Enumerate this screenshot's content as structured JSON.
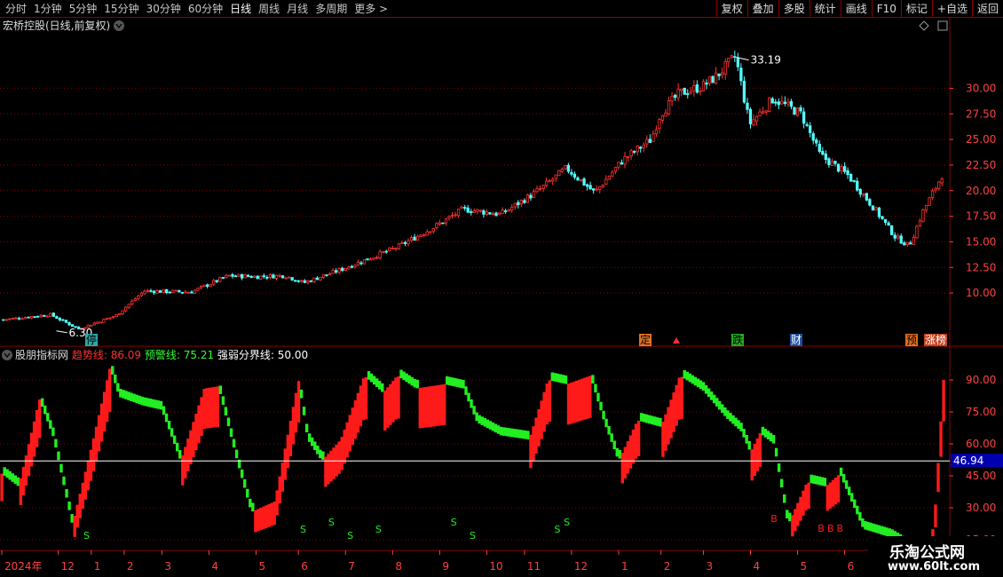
{
  "toolbar": {
    "periods": [
      "分时",
      "1分钟",
      "5分钟",
      "15分钟",
      "30分钟",
      "60分钟",
      "日线",
      "周线",
      "月线",
      "多周期",
      "更多 >"
    ],
    "active_period": "日线",
    "tools": [
      "复权",
      "叠加",
      "多股",
      "统计",
      "画线",
      "F10",
      "标记",
      "+自选",
      "返回"
    ]
  },
  "stock": {
    "title": "宏桥控股(日线,前复权)",
    "high_label": "33.19",
    "low_label": "6.30"
  },
  "markers": {
    "ting": "停",
    "ding": "定",
    "die": "跌",
    "cai": "财",
    "yu": "预",
    "zhangbang": "涨榜"
  },
  "indicator": {
    "name": "股朋指标网",
    "trend_label": "趋势线:",
    "trend_value": "86.09",
    "warn_label": "预警线:",
    "warn_value": "75.21",
    "bound_label": "强弱分界线:",
    "bound_value": "50.00",
    "crosshair_value": "46.94",
    "sell_label": "S",
    "buy_label": "B"
  },
  "watermark": {
    "title": "乐淘公式网",
    "url": "www.60lt.com"
  },
  "colors": {
    "up": "#ff3232",
    "down": "#54ffff",
    "red_fill": "#ff1a1a",
    "green_fill": "#22ee22",
    "grid": "#8b0000",
    "axis_text": "#ff4040",
    "white": "#ffffff"
  },
  "chart_data": [
    {
      "type": "candlestick",
      "ylim": [
        5.5,
        35.5
      ],
      "y_ticks": [
        "30.00",
        "27.50",
        "25.00",
        "22.50",
        "20.00",
        "17.50",
        "15.00",
        "12.50",
        "10.00"
      ],
      "y_tick_values": [
        30,
        27.5,
        25,
        22.5,
        20,
        17.5,
        15,
        12.5,
        10
      ],
      "close_path": [
        [
          0,
          7.4
        ],
        [
          0.05,
          7.9
        ],
        [
          0.08,
          6.5
        ],
        [
          0.12,
          7.8
        ],
        [
          0.15,
          10.2
        ],
        [
          0.2,
          10.1
        ],
        [
          0.24,
          11.7
        ],
        [
          0.27,
          11.6
        ],
        [
          0.3,
          11.7
        ],
        [
          0.32,
          11.0
        ],
        [
          0.36,
          12.3
        ],
        [
          0.42,
          14.5
        ],
        [
          0.46,
          16.5
        ],
        [
          0.49,
          18.2
        ],
        [
          0.53,
          17.7
        ],
        [
          0.57,
          20.0
        ],
        [
          0.6,
          22.2
        ],
        [
          0.63,
          19.8
        ],
        [
          0.66,
          23.0
        ],
        [
          0.69,
          25.0
        ],
        [
          0.7,
          27.5
        ],
        [
          0.72,
          29.5
        ],
        [
          0.745,
          30.2
        ],
        [
          0.76,
          31.2
        ],
        [
          0.78,
          33.1
        ],
        [
          0.795,
          26.5
        ],
        [
          0.82,
          29.0
        ],
        [
          0.85,
          27.5
        ],
        [
          0.87,
          23.5
        ],
        [
          0.9,
          21.5
        ],
        [
          0.93,
          18.0
        ],
        [
          0.95,
          15.5
        ],
        [
          0.965,
          14.6
        ],
        [
          0.98,
          18.0
        ],
        [
          1.0,
          21.5
        ]
      ]
    },
    {
      "type": "area",
      "ylim": [
        10,
        100
      ],
      "y_ticks": [
        "90.00",
        "75.00",
        "60.00",
        "45.00",
        "30.00",
        "15.00"
      ],
      "y_tick_values": [
        90,
        75,
        60,
        45,
        30,
        15
      ],
      "reference_line": 50,
      "crosshair": 46.94,
      "series": [
        {
          "name": "趋势线",
          "last": 86.09
        },
        {
          "name": "预警线",
          "last": 75.21
        },
        {
          "name": "强弱分界线",
          "last": 50.0
        }
      ],
      "trend_path": [
        [
          0.0,
          46
        ],
        [
          0.018,
          40
        ],
        [
          0.04,
          81
        ],
        [
          0.055,
          63
        ],
        [
          0.075,
          22
        ],
        [
          0.095,
          58
        ],
        [
          0.115,
          96
        ],
        [
          0.125,
          82
        ],
        [
          0.15,
          78
        ],
        [
          0.17,
          76
        ],
        [
          0.19,
          52
        ],
        [
          0.215,
          86
        ],
        [
          0.23,
          87
        ],
        [
          0.25,
          52
        ],
        [
          0.265,
          28
        ],
        [
          0.29,
          33
        ],
        [
          0.315,
          90
        ],
        [
          0.325,
          62
        ],
        [
          0.34,
          52
        ],
        [
          0.36,
          62
        ],
        [
          0.385,
          92
        ],
        [
          0.405,
          84
        ],
        [
          0.42,
          92
        ],
        [
          0.44,
          86
        ],
        [
          0.47,
          88
        ],
        [
          0.49,
          86
        ],
        [
          0.505,
          70
        ],
        [
          0.53,
          64
        ],
        [
          0.56,
          62
        ],
        [
          0.58,
          90
        ],
        [
          0.6,
          88
        ],
        [
          0.625,
          92
        ],
        [
          0.64,
          70
        ],
        [
          0.655,
          52
        ],
        [
          0.675,
          71
        ],
        [
          0.7,
          68
        ],
        [
          0.72,
          92
        ],
        [
          0.745,
          85
        ],
        [
          0.77,
          72
        ],
        [
          0.785,
          66
        ],
        [
          0.795,
          56
        ],
        [
          0.805,
          65
        ],
        [
          0.82,
          60
        ],
        [
          0.835,
          22
        ],
        [
          0.855,
          42
        ],
        [
          0.875,
          40
        ],
        [
          0.89,
          46
        ],
        [
          0.915,
          20
        ],
        [
          0.945,
          16
        ],
        [
          0.96,
          12
        ],
        [
          0.98,
          8
        ],
        [
          0.99,
          22
        ],
        [
          1.0,
          90
        ]
      ],
      "sell_markers": [
        0.09,
        0.32,
        0.35,
        0.37,
        0.4,
        0.48,
        0.5,
        0.59,
        0.6
      ],
      "buy_markers": [
        0.82,
        0.87,
        0.88,
        0.89
      ]
    }
  ],
  "x_axis": {
    "labels": [
      "2024年",
      "12",
      "1",
      "2",
      "3",
      "4",
      "5",
      "6",
      "7",
      "8",
      "9",
      "10",
      "11",
      "12",
      "1",
      "2",
      "3",
      "4",
      "5",
      "6"
    ],
    "fractions": [
      0.0,
      0.06,
      0.095,
      0.13,
      0.17,
      0.22,
      0.27,
      0.315,
      0.365,
      0.415,
      0.465,
      0.515,
      0.555,
      0.605,
      0.655,
      0.7,
      0.745,
      0.795,
      0.845,
      0.895
    ]
  }
}
